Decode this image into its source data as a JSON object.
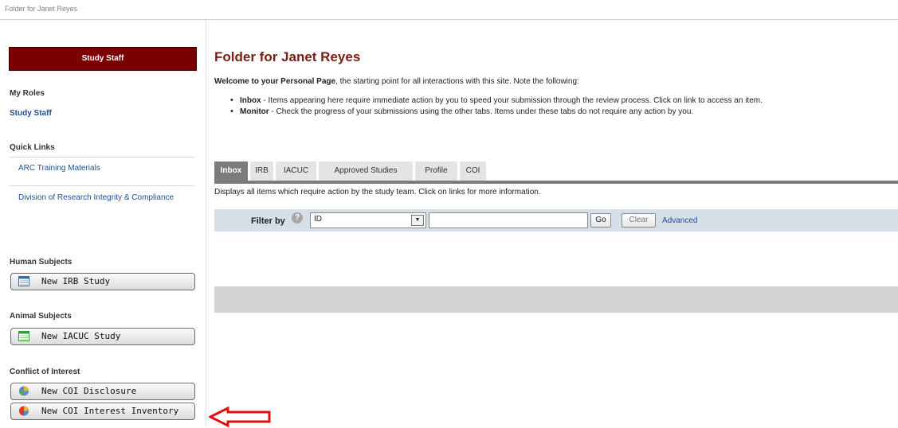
{
  "topbar": {
    "breadcrumb": "Folder for Janet Reyes"
  },
  "sidebar": {
    "role_box": "Study Staff",
    "my_roles": {
      "title": "My Roles",
      "items": [
        "Study Staff"
      ]
    },
    "quick_links": {
      "title": "Quick Links",
      "items": [
        "ARC Training Materials",
        "Division of Research Integrity & Compliance"
      ]
    },
    "human_subjects": {
      "title": "Human Subjects",
      "button": "New IRB Study"
    },
    "animal_subjects": {
      "title": "Animal Subjects",
      "button": "New IACUC Study"
    },
    "conflict_of_interest": {
      "title": "Conflict of Interest",
      "buttons": [
        "New COI Disclosure",
        "New COI Interest Inventory"
      ]
    }
  },
  "main": {
    "title": "Folder for Janet Reyes",
    "welcome_bold": "Welcome to your Personal Page",
    "welcome_rest": ", the starting point for all interactions with this site.  Note the following:",
    "bullets": [
      {
        "term": "Inbox",
        "text": " - Items appearing here require immediate action by you to speed your submission through the review process.  Click on link to access an item."
      },
      {
        "term": "Monitor",
        "text": " - Check the progress of your submissions using the other tabs.  Items under these tabs do not require any action by you."
      }
    ],
    "tabs": [
      "Inbox",
      "IRB",
      "IACUC",
      "Approved Studies",
      "Profile",
      "COI"
    ],
    "active_tab": "Inbox",
    "tab_description": "Displays all items which require action by the study team. Click on links for more information.",
    "filter": {
      "label": "Filter by",
      "help": "?",
      "selected": "ID",
      "search_value": "",
      "go": "Go",
      "clear": "Clear",
      "advanced": "Advanced"
    }
  },
  "colors": {
    "accent": "#7a0000",
    "title": "#7a1d12",
    "link": "#1f4f8f",
    "filter_bg": "#d6dee7",
    "arrow": "#e01010"
  }
}
